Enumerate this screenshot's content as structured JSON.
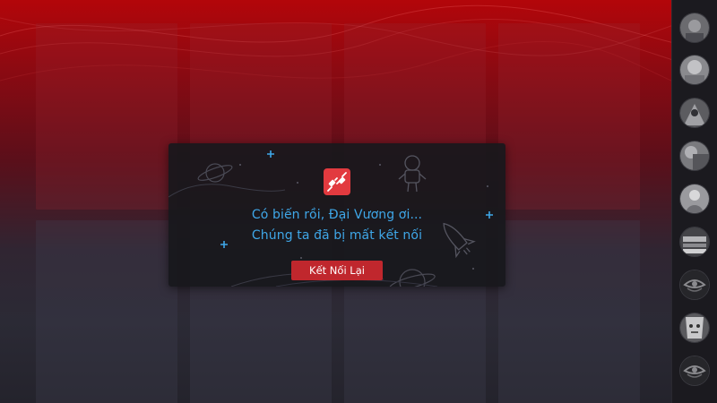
{
  "modal": {
    "line1": "Có biến rồi, Đại Vương ơi...",
    "line2": "Chúng ta đã bị mất kết nối",
    "reconnect_label": "Kết Nối Lại",
    "icon": "unplugged-icon"
  },
  "colors": {
    "accent": "#e23a3f",
    "button": "#c0272d",
    "message": "#3fa7e8",
    "sidebar": "#1b1a1f"
  },
  "sidebar": {
    "avatars": [
      {
        "name": "friend-avatar-1"
      },
      {
        "name": "friend-avatar-2"
      },
      {
        "name": "friend-avatar-3"
      },
      {
        "name": "friend-avatar-4"
      },
      {
        "name": "friend-avatar-5"
      },
      {
        "name": "friend-avatar-6"
      },
      {
        "name": "friend-avatar-7"
      },
      {
        "name": "friend-avatar-8"
      },
      {
        "name": "friend-avatar-9"
      }
    ]
  }
}
